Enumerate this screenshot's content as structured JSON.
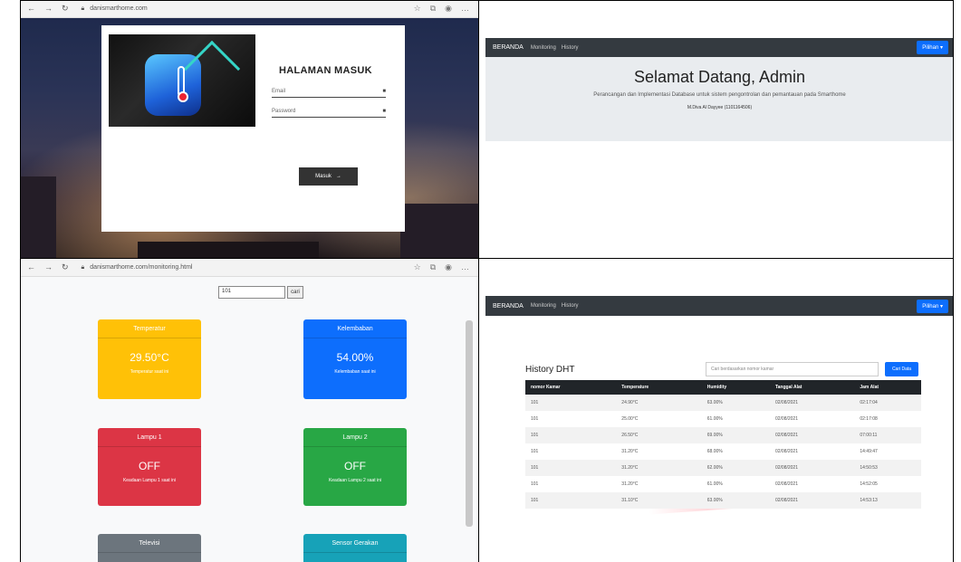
{
  "login": {
    "browser": {
      "url": "danismarthome.com"
    },
    "title": "HALAMAN MASUK",
    "email_placeholder": "Email",
    "password_placeholder": "Password",
    "submit_label": "Masuk"
  },
  "beranda": {
    "navbar": {
      "brand": "BERANDA",
      "links": [
        "Monitoring",
        "History"
      ],
      "dropdown": "Pilihan"
    },
    "welcome": "Selamat Datang, Admin",
    "subtitle": "Perancangan dan Implementasi Database untuk sistem pengontrolan dan pemantauan pada Smarthome",
    "author": "M.Diva Al Dayyee (1101164506)"
  },
  "monitoring": {
    "browser": {
      "url": "danismarthome.com/monitoring.html"
    },
    "search_value": "101",
    "search_button": "cari",
    "cards": [
      {
        "title": "Temperatur",
        "value": "29.50°C",
        "caption": "Temperatur saat ini",
        "color": "#ffc107"
      },
      {
        "title": "Kelembaban",
        "value": "54.00%",
        "caption": "Kelembaban saat ini",
        "color": "#0d6efd"
      },
      {
        "title": "Lampu 1",
        "value": "OFF",
        "caption": "Keadaan Lampu 1 saat ini",
        "color": "#dc3545"
      },
      {
        "title": "Lampu 2",
        "value": "OFF",
        "caption": "Keadaan Lampu 2 saat ini",
        "color": "#28a745"
      },
      {
        "title": "Televisi",
        "value": "",
        "caption": "",
        "color": "#6c757d"
      },
      {
        "title": "Sensor Gerakan",
        "value": "",
        "caption": "",
        "color": "#17a2b8"
      }
    ]
  },
  "history": {
    "navbar": {
      "brand": "BERANDA",
      "links": [
        "Monitoring",
        "History"
      ],
      "dropdown": "Pilihan"
    },
    "title": "History DHT",
    "search_placeholder": "Cari berdasarkan nomor kamar",
    "search_button": "Cari Data",
    "columns": [
      "nomor Kamar",
      "Temperature",
      "Humidity",
      "Tanggal Alat",
      "Jam Alat"
    ],
    "rows": [
      [
        "101",
        "24.90°C",
        "63.00%",
        "02/08/2021",
        "02:17:04"
      ],
      [
        "101",
        "25.00°C",
        "61.00%",
        "02/08/2021",
        "02:17:08"
      ],
      [
        "101",
        "26.50°C",
        "69.00%",
        "02/08/2021",
        "07:00:11"
      ],
      [
        "101",
        "31.20°C",
        "68.00%",
        "02/08/2021",
        "14:49:47"
      ],
      [
        "101",
        "31.20°C",
        "62.00%",
        "02/08/2021",
        "14:50:53"
      ],
      [
        "101",
        "31.20°C",
        "61.00%",
        "02/08/2021",
        "14:52:05"
      ],
      [
        "101",
        "31.10°C",
        "63.00%",
        "02/08/2021",
        "14:53:13"
      ]
    ]
  }
}
